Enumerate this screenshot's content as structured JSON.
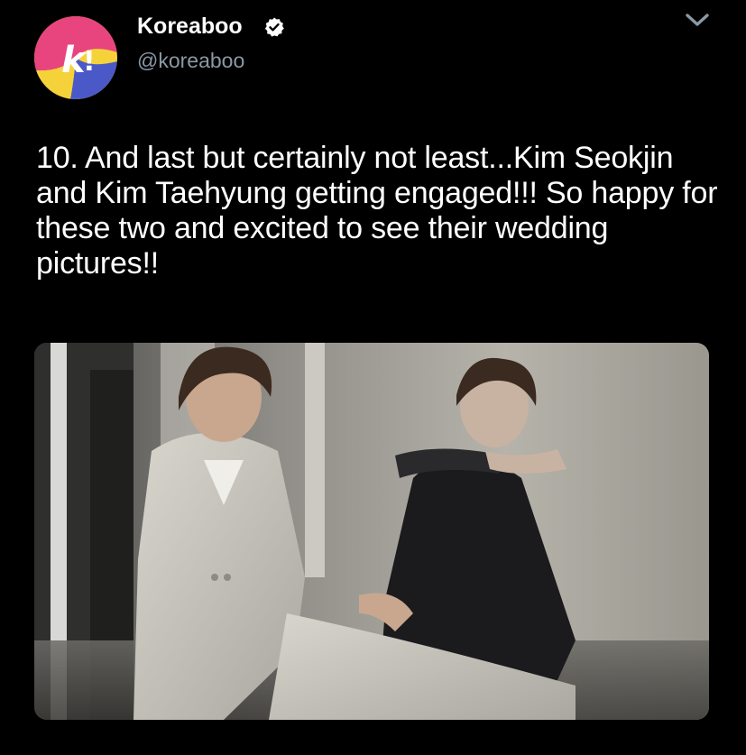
{
  "account": {
    "display_name": "Koreaboo",
    "handle": "@koreaboo",
    "verified_icon": "verified-badge-icon",
    "avatar_letter": "k!"
  },
  "tweet": {
    "text": "10. And last but certainly not least...Kim Seokjin and Kim Taehyung getting engaged!!! So happy for these two and excited to see their wedding pictures!!"
  },
  "icons": {
    "menu": "chevron-down-icon"
  },
  "colors": {
    "background": "#000000",
    "handle": "#8b98a5",
    "avatar_pink": "#e8457f",
    "avatar_yellow": "#f6d23a",
    "avatar_blue": "#4b59c8"
  }
}
